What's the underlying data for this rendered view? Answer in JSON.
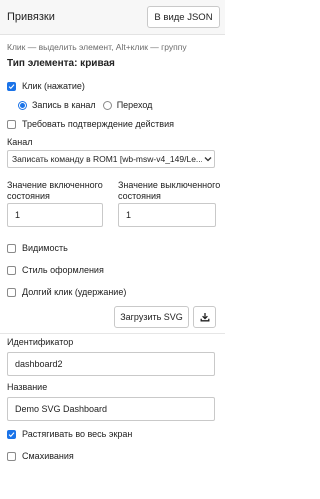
{
  "header": {
    "title": "Привязки",
    "json_button": "В виде JSON"
  },
  "hint": "Клик — выделить элемент, Alt+клик — группу",
  "element_type": "Тип элемента: кривая",
  "click": {
    "label": "Клик (нажатие)",
    "checked": true
  },
  "click_mode": {
    "options": [
      {
        "label": "Запись в канал",
        "selected": true
      },
      {
        "label": "Переход",
        "selected": false
      }
    ]
  },
  "confirm": {
    "label": "Требовать подтверждение действия",
    "checked": false
  },
  "channel": {
    "label": "Канал",
    "value": "Записать команду в ROM1 [wb-msw-v4_149/Le..."
  },
  "on_value": {
    "label_line1": "Значение включенного",
    "label_line2": "состояния",
    "value": "1"
  },
  "off_value": {
    "label_line1": "Значение выключенного",
    "label_line2": "состояния",
    "value": "1"
  },
  "visibility": {
    "label": "Видимость",
    "checked": false
  },
  "style": {
    "label": "Стиль оформления",
    "checked": false
  },
  "long_click": {
    "label": "Долгий клик (удержание)",
    "checked": false
  },
  "load_svg": {
    "label": "Загрузить SVG"
  },
  "identifier": {
    "label": "Идентификатор",
    "value": "dashboard2"
  },
  "name": {
    "label": "Название",
    "value": "Demo SVG Dashboard"
  },
  "stretch": {
    "label": "Растягивать во весь экран",
    "checked": true
  },
  "swipe": {
    "label": "Смахивания",
    "checked": false
  },
  "colors": {
    "accent": "#1a73e8",
    "border": "#c9c9c9",
    "header_bg": "#f7f7f7"
  }
}
